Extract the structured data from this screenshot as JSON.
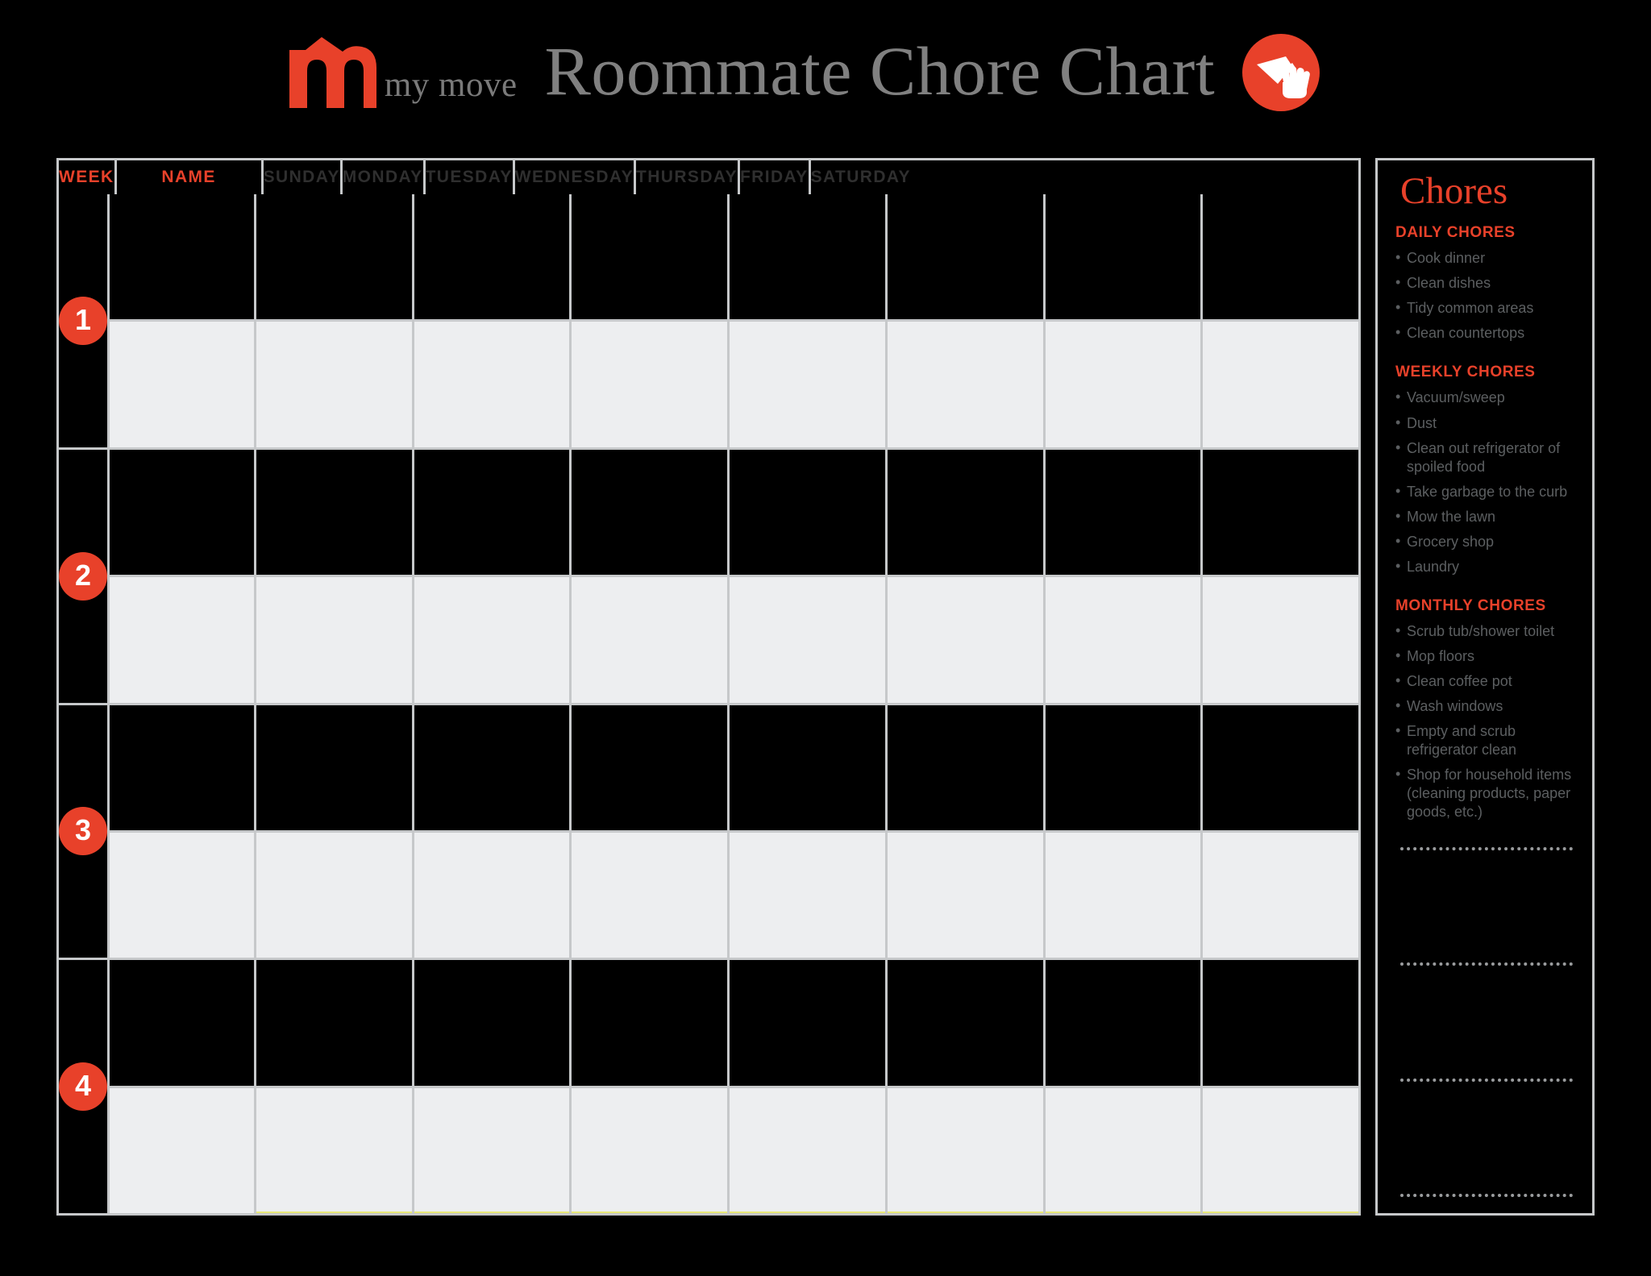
{
  "brand": {
    "logo_mark": "m-logo-icon",
    "logo_word": "my move"
  },
  "header": {
    "title": "Roommate Chore Chart",
    "badge_icon": "cleaning-hand-icon"
  },
  "colors": {
    "accent": "#E8412A",
    "grid_line": "#c6c8ca",
    "dark_cell": "#000000",
    "light_cell": "#edeef0",
    "header_text": "#2f2f2f",
    "title_gray": "#808080",
    "chore_text": "#5c5f61"
  },
  "table": {
    "columns": [
      {
        "label": "WEEK",
        "accent": true
      },
      {
        "label": "NAME",
        "accent": true
      },
      {
        "label": "SUNDAY",
        "accent": false
      },
      {
        "label": "MONDAY",
        "accent": false
      },
      {
        "label": "TUESDAY",
        "accent": false
      },
      {
        "label": "WEDNESDAY",
        "accent": false
      },
      {
        "label": "THURSDAY",
        "accent": false
      },
      {
        "label": "FRIDAY",
        "accent": false
      },
      {
        "label": "SATURDAY",
        "accent": false
      }
    ],
    "weeks": [
      {
        "number": "1"
      },
      {
        "number": "2"
      },
      {
        "number": "3"
      },
      {
        "number": "4"
      }
    ]
  },
  "sidebar": {
    "title": "Chores",
    "groups": [
      {
        "title": "DAILY CHORES",
        "items": [
          "Cook dinner",
          "Clean dishes",
          "Tidy common areas",
          "Clean countertops"
        ]
      },
      {
        "title": "WEEKLY CHORES",
        "items": [
          "Vacuum/sweep",
          "Dust",
          "Clean out refrigerator of spoiled food",
          "Take garbage to the curb",
          "Mow the lawn",
          "Grocery shop",
          "Laundry"
        ]
      },
      {
        "title": "MONTHLY CHORES",
        "items": [
          "Scrub tub/shower toilet",
          "Mop floors",
          "Clean coffee pot",
          "Wash windows",
          "Empty and scrub refrigerator clean",
          "Shop for household items (cleaning products, paper goods, etc.)"
        ]
      }
    ],
    "blank_line_count": 4
  }
}
